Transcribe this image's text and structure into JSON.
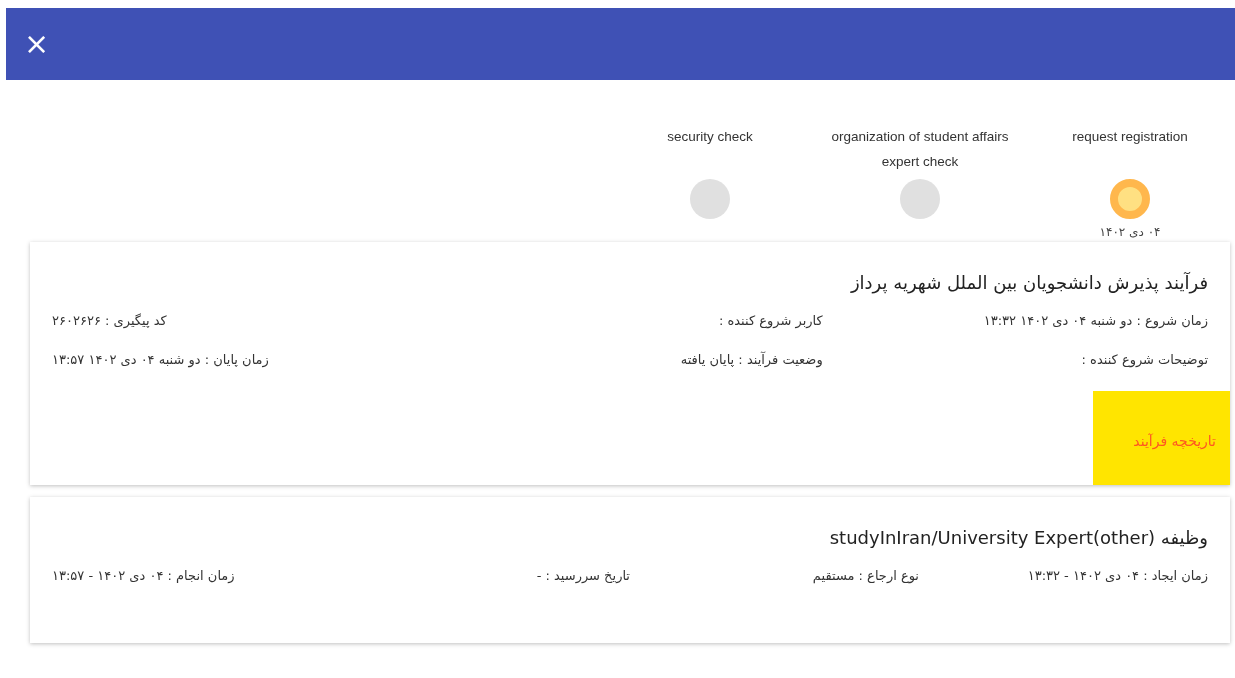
{
  "header": {
    "close_label": "×"
  },
  "steps": [
    {
      "label": "request registration",
      "selected": true,
      "date": "۰۴ دی ۱۴۰۲"
    },
    {
      "label": "organization of student affairs expert check",
      "selected": false
    },
    {
      "label": "security check",
      "selected": false
    }
  ],
  "process_card": {
    "title": "فرآیند پذیرش دانشجویان بین الملل شهریه پرداز",
    "fields": [
      "زمان شروع : دو شنبه ۰۴ دی ۱۴۰۲ ۱۳:۳۲",
      "کاربر شروع کننده :",
      "کد پیگیری : ۲۶۰۲۶۲۶",
      "توضیحات شروع کننده :",
      "وضعیت فرآیند : پایان یافته",
      "زمان پایان : دو شنبه ۰۴ دی ۱۴۰۲ ۱۳:۵۷"
    ],
    "history_link": {
      "label": "تاریخچه فرآیند",
      "highlighted": true
    }
  },
  "task_card": {
    "title": "وظیفه (studyInIran/University Expert(other",
    "fields": [
      "زمان ایجاد : ۰۴ دی ۱۴۰۲ - ۱۳:۳۲",
      "نوع ارجاع : مستقیم",
      "تاریخ سررسید : -",
      "زمان انجام : ۰۴ دی ۱۴۰۲ - ۱۳:۵۷"
    ]
  }
}
